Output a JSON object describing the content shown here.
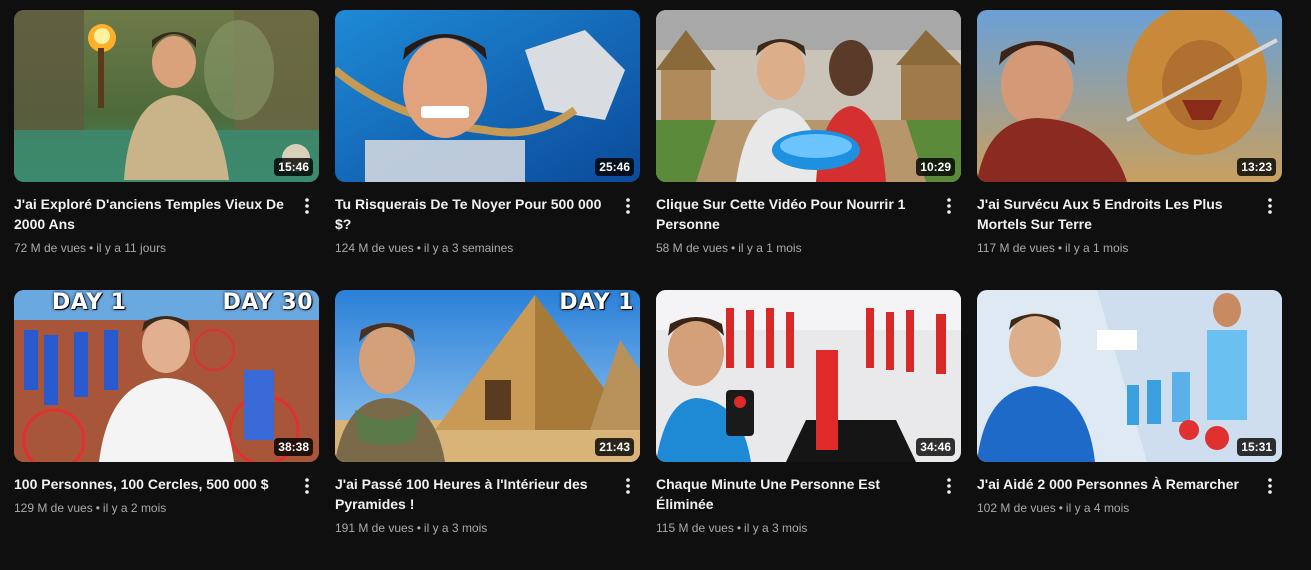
{
  "videos": [
    {
      "title": "J'ai Exploré D'anciens Temples Vieux De 2000 Ans",
      "views": "72 M de vues",
      "age": "il y a 11 jours",
      "duration": "15:46"
    },
    {
      "title": "Tu Risquerais De Te Noyer Pour 500 000 $?",
      "views": "124 M de vues",
      "age": "il y a 3 semaines",
      "duration": "25:46"
    },
    {
      "title": "Clique Sur Cette Vidéo Pour Nourrir 1 Personne",
      "views": "58 M de vues",
      "age": "il y a 1 mois",
      "duration": "10:29"
    },
    {
      "title": "J'ai Survécu Aux 5 Endroits Les Plus Mortels Sur Terre",
      "views": "117 M de vues",
      "age": "il y a 1 mois",
      "duration": "13:23"
    },
    {
      "title": "100 Personnes, 100 Cercles, 500 000 $",
      "views": "129 M de vues",
      "age": "il y a 2 mois",
      "duration": "38:38",
      "overlay_left": "DAY 1",
      "overlay_right": "DAY 30"
    },
    {
      "title": "J'ai Passé 100 Heures à l'Intérieur des Pyramides !",
      "views": "191 M de vues",
      "age": "il y a 3 mois",
      "duration": "21:43",
      "overlay_right": "DAY 1"
    },
    {
      "title": "Chaque Minute Une Personne Est Éliminée",
      "views": "115 M de vues",
      "age": "il y a 3 mois",
      "duration": "34:46"
    },
    {
      "title": "J'ai Aidé 2 000 Personnes À Remarcher",
      "views": "102 M de vues",
      "age": "il y a 4 mois",
      "duration": "15:31"
    }
  ],
  "separator": "•",
  "more_icon": "vertical-dots-icon"
}
